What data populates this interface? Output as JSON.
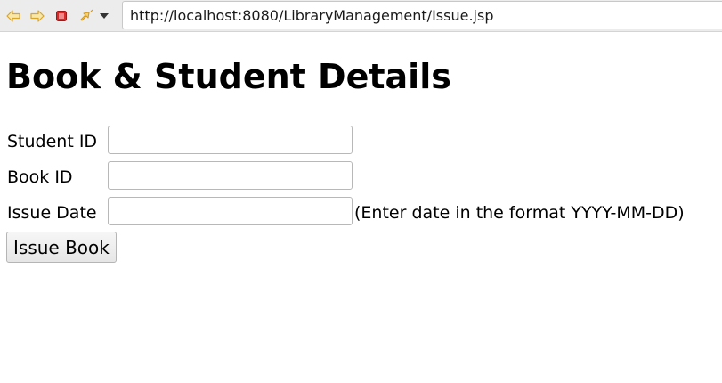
{
  "browser": {
    "url": "http://localhost:8080/LibraryManagement/Issue.jsp",
    "icons": {
      "back": "back-arrow-icon",
      "forward": "forward-arrow-icon",
      "stop": "stop-icon",
      "go": "go-refresh-icon",
      "dropdown": "chevron-down-icon"
    },
    "colors": {
      "nav_arrow": "#e8b233",
      "stop": "#cc2222"
    }
  },
  "page": {
    "title": "Book & Student Details"
  },
  "form": {
    "student_id": {
      "label": "Student ID",
      "value": ""
    },
    "book_id": {
      "label": "Book ID",
      "value": ""
    },
    "issue_date": {
      "label": "Issue Date",
      "value": "",
      "hint": "(Enter date in the format YYYY-MM-DD)"
    },
    "submit_label": "Issue Book"
  }
}
